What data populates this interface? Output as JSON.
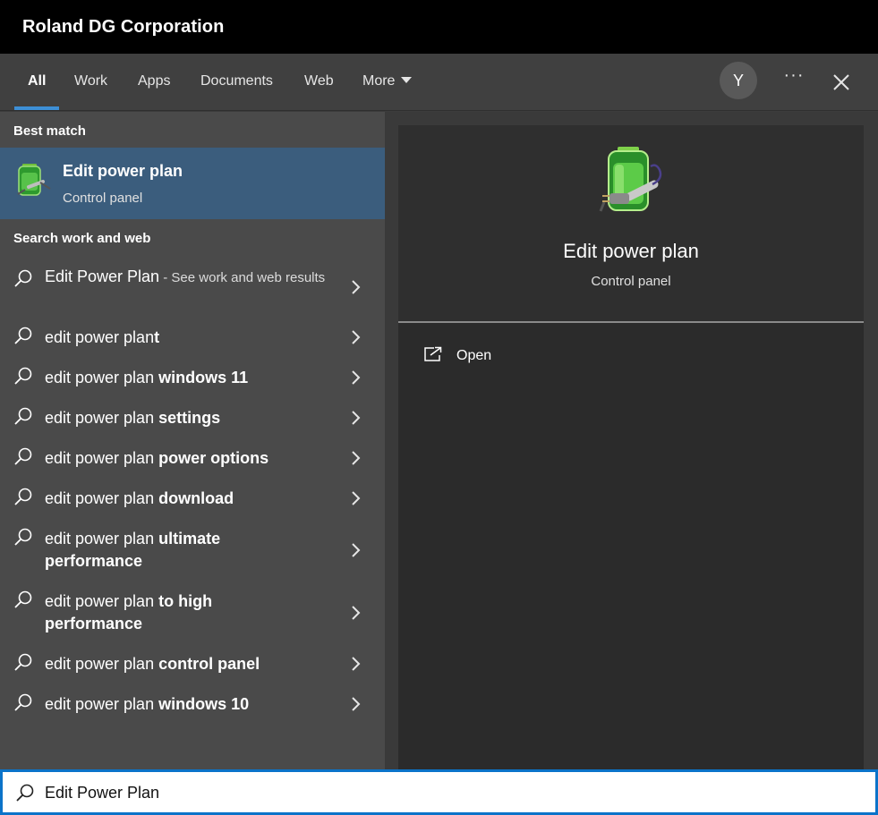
{
  "titlebar": {
    "org": "Roland DG Corporation"
  },
  "tabs": [
    {
      "label": "All"
    },
    {
      "label": "Work"
    },
    {
      "label": "Apps"
    },
    {
      "label": "Documents"
    },
    {
      "label": "Web"
    },
    {
      "label": "More"
    }
  ],
  "account": {
    "initial": "Y"
  },
  "header_actions": {
    "more": "···"
  },
  "left": {
    "best_match_label": "Best match",
    "best_match": {
      "title": "Edit power plan",
      "subtitle": "Control panel",
      "icon": "battery-plug-icon"
    },
    "search_label": "Search work and web",
    "suggestions": [
      {
        "plain": "Edit Power Plan",
        "bold": "",
        "see": " - See work and web results"
      },
      {
        "plain": "edit power plan",
        "bold": "t",
        "see": ""
      },
      {
        "plain": "edit power plan ",
        "bold": "windows 11",
        "see": ""
      },
      {
        "plain": "edit power plan ",
        "bold": "settings",
        "see": ""
      },
      {
        "plain": "edit power plan ",
        "bold": "power options",
        "see": ""
      },
      {
        "plain": "edit power plan ",
        "bold": "download",
        "see": ""
      },
      {
        "plain": "edit power plan ",
        "bold": "ultimate performance",
        "see": ""
      },
      {
        "plain": "edit power plan ",
        "bold": "to high performance",
        "see": ""
      },
      {
        "plain": "edit power plan ",
        "bold": "control panel",
        "see": ""
      },
      {
        "plain": "edit power plan ",
        "bold": "windows 10",
        "see": ""
      }
    ]
  },
  "preview": {
    "title": "Edit power plan",
    "subtitle": "Control panel",
    "actions": [
      {
        "label": "Open",
        "icon": "open-external-icon"
      }
    ]
  },
  "search": {
    "value": "Edit Power Plan",
    "placeholder": ""
  },
  "colors": {
    "accent": "#0b73c9",
    "selected": "#3b5d7d",
    "underline": "#3d8fd6"
  }
}
